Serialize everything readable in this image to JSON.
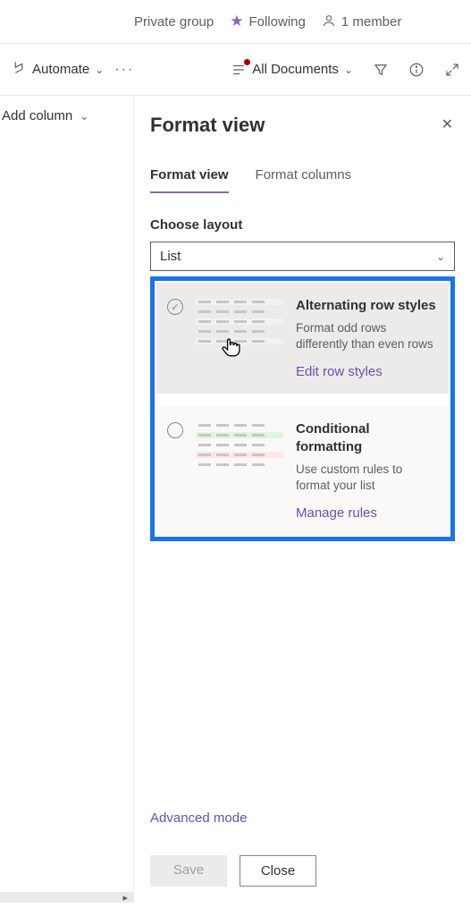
{
  "header": {
    "group_type": "Private group",
    "following_label": "Following",
    "member_count": "1 member"
  },
  "cmdbar": {
    "automate_label": "Automate",
    "views_label": "All Documents"
  },
  "left": {
    "add_column": "Add column"
  },
  "panel": {
    "title": "Format view",
    "tabs": {
      "view": "Format view",
      "columns": "Format columns"
    },
    "layout_label": "Choose layout",
    "layout_value": "List",
    "options": {
      "alt": {
        "title": "Alternating row styles",
        "desc": "Format odd rows differently than even rows",
        "link": "Edit row styles"
      },
      "cond": {
        "title": "Conditional formatting",
        "desc": "Use custom rules to format your list",
        "link": "Manage rules"
      }
    },
    "advanced": "Advanced mode",
    "save": "Save",
    "close": "Close"
  }
}
